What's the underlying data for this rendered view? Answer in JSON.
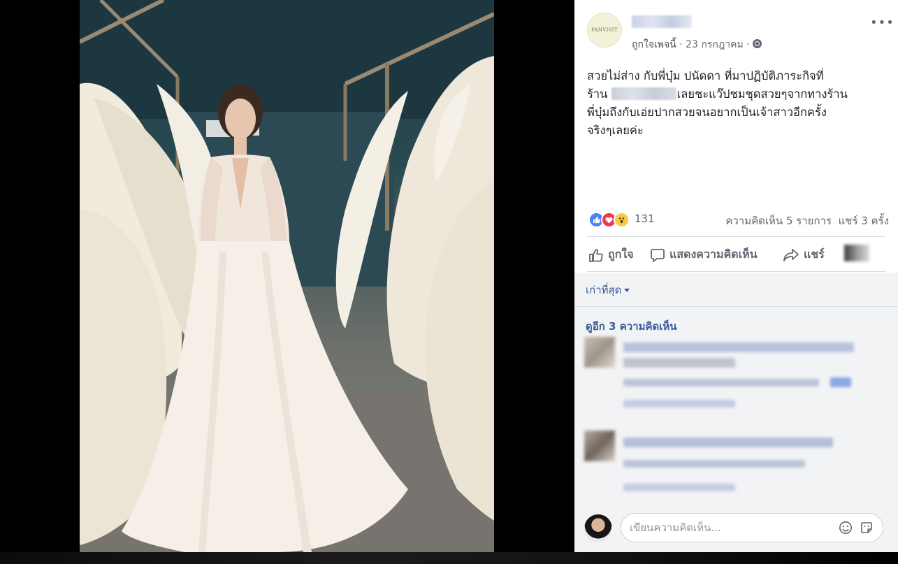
{
  "post": {
    "page_logo_text": "PANVISIT",
    "meta_like_page": "ถูกใจเพจนี้",
    "meta_separator": " · ",
    "date": "23 กรกฎาคม",
    "more_label": "•••",
    "text_line1": "สวยไม่ส่าง กับพี่บุ๋ม ปนัดดา ที่มาปฏิบัติภาระกิจที่",
    "text_line2_prefix": "ร้าน ",
    "text_line2_suffix": "เลยชะแว๊ปชมชุดสวยๆจากทางร้าน",
    "text_line3": "พี่บุ๋มถึงกับเอ่ยปากสวยจนอยากเป็นเจ้าสาวอีกครั้ง",
    "text_line4": "จริงๆเลยค่ะ"
  },
  "stats": {
    "reaction_count": "131",
    "comments_count": "ความคิดเห็น 5 รายการ",
    "shares_count": "แชร์ 3 ครั้ง"
  },
  "actions": {
    "like": "ถูกใจ",
    "comment": "แสดงความคิดเห็น",
    "share": "แชร์"
  },
  "comments": {
    "sort_label": "เก่าที่สุด",
    "view_more": "ดูอีก 3 ความคิดเห็น",
    "input_placeholder": "เขียนความคิดเห็น..."
  },
  "icons": {
    "globe": "globe-icon",
    "like": "thumbs-up-icon",
    "comment": "speech-bubble-icon",
    "share": "share-arrow-icon",
    "emoji": "smiley-icon",
    "sticker": "sticker-icon"
  },
  "colors": {
    "link": "#385898",
    "like_reaction": "#4f7ef6",
    "love_reaction": "#f0384f",
    "wow_reaction": "#f7c947"
  }
}
